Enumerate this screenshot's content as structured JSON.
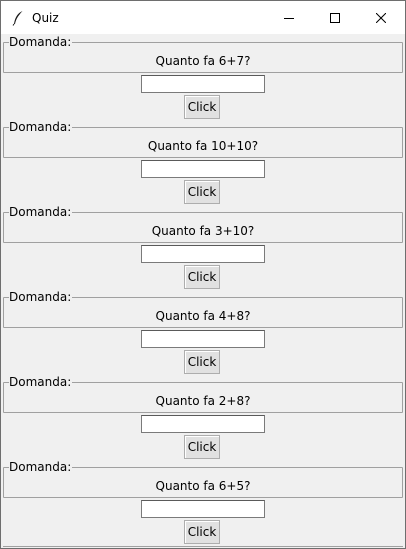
{
  "window": {
    "title": "Quiz",
    "icon": "feather-icon"
  },
  "quiz": {
    "legend": "Domanda:",
    "button_label": "Click",
    "questions": [
      {
        "text": "Quanto fa 6+7?",
        "answer": ""
      },
      {
        "text": "Quanto fa 10+10?",
        "answer": ""
      },
      {
        "text": "Quanto fa 3+10?",
        "answer": ""
      },
      {
        "text": "Quanto fa 4+8?",
        "answer": ""
      },
      {
        "text": "Quanto fa 2+8?",
        "answer": ""
      },
      {
        "text": "Quanto fa 6+5?",
        "answer": ""
      }
    ]
  }
}
